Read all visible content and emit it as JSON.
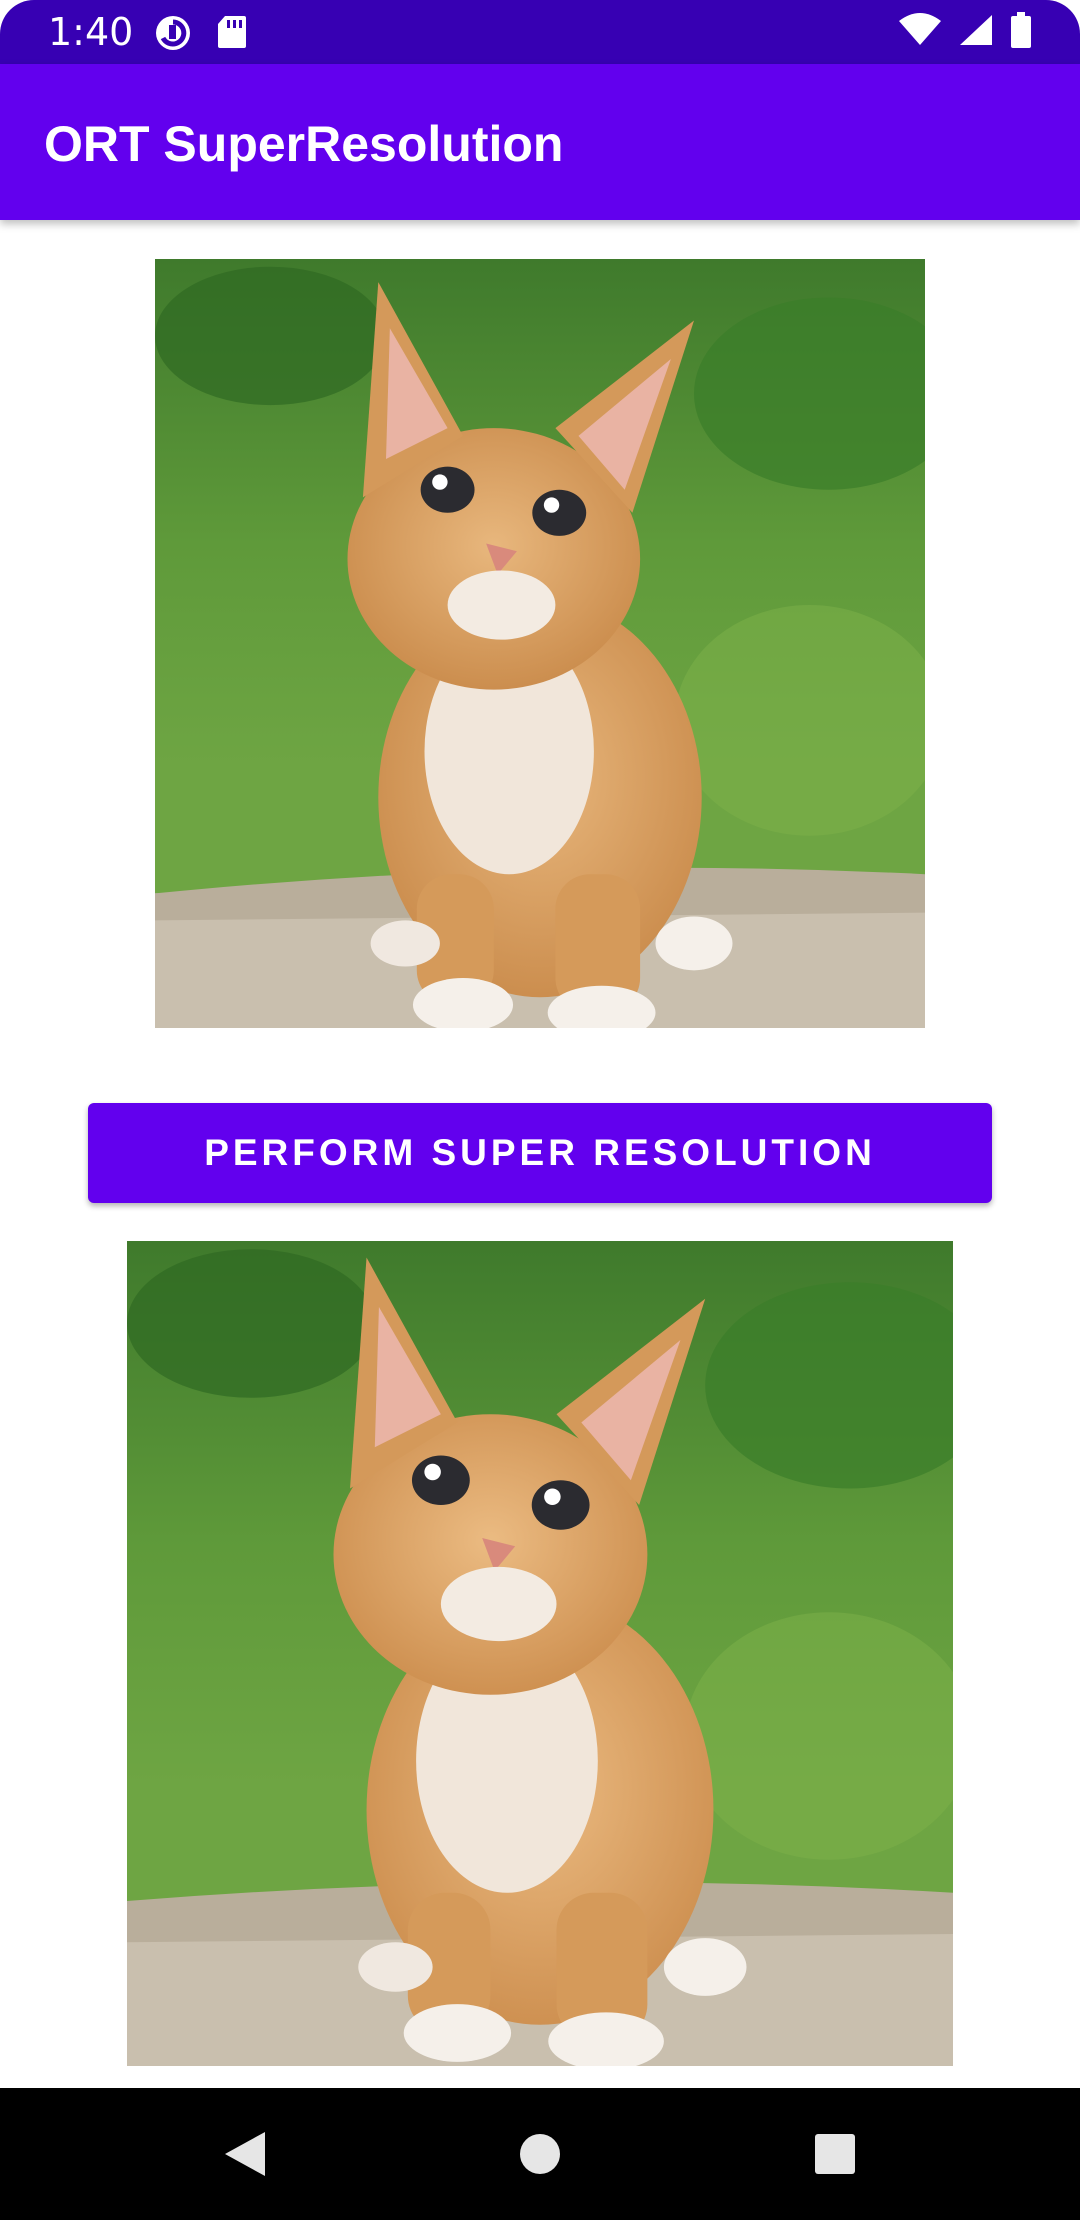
{
  "status_bar": {
    "time": "1:40",
    "left_icons": [
      "data-saver-icon",
      "sd-card-icon"
    ],
    "right_icons": [
      "wifi-icon",
      "cell-signal-icon",
      "battery-icon"
    ]
  },
  "app_bar": {
    "title": "ORT SuperResolution"
  },
  "main": {
    "input_image": {
      "icon": "kitten-photo-low-res"
    },
    "perform_button_label": "PERFORM SUPER RESOLUTION",
    "output_image": {
      "icon": "kitten-photo-super-resolved"
    }
  },
  "nav_bar": {
    "buttons": [
      "back-icon",
      "home-icon",
      "recents-icon"
    ]
  },
  "colors": {
    "status_bar": "#3700b3",
    "primary": "#6200ee",
    "background": "#ffffff",
    "nav_bar": "#000000"
  }
}
